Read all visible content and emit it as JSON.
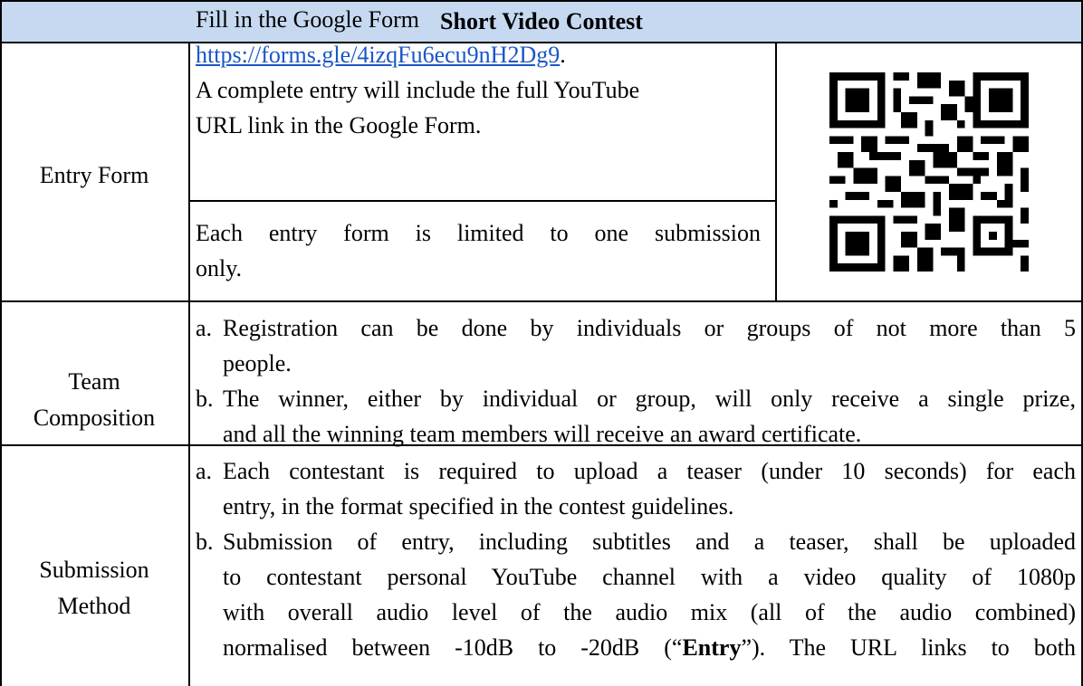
{
  "header": {
    "title": "Short Video Contest"
  },
  "entry_form": {
    "label": "Entry Form",
    "line1": "Fill in the Google Form",
    "link": "https://forms.gle/4izqFu6ecu9nH2Dg9",
    "link_suffix": ".",
    "line3": "A complete entry will include the full YouTube",
    "line4": "URL link in the Google Form.",
    "limit_line1": "Each entry form is limited to one submission",
    "limit_line2": "only.",
    "qr_icon": "qr-code-icon"
  },
  "team_composition": {
    "label_line1": "Team",
    "label_line2": "Composition",
    "items": [
      {
        "marker": "a.",
        "line1": "Registration can be done by individuals or groups of not more than 5",
        "line2": "people."
      },
      {
        "marker": "b.",
        "line1": "The winner, either by individual or group, will only receive a single prize,",
        "line2": "and all the winning team members will receive an award certificate."
      }
    ]
  },
  "submission_method": {
    "label_line1": "Submission",
    "label_line2": "Method",
    "items": [
      {
        "marker": "a.",
        "line1": "Each contestant is required to upload a teaser (under 10 seconds) for each",
        "line2": "entry, in the format specified in the contest guidelines."
      },
      {
        "marker": "b.",
        "line1": "Submission of entry, including subtitles and a teaser, shall be uploaded",
        "line2": "to contestant personal YouTube channel with a video quality of 1080p",
        "line3": "with overall audio level of the audio mix (all of the audio combined)",
        "line4_pre": "normalised between -10dB to -20dB (“",
        "line4_bold": "Entry",
        "line4_post": "”). The URL links to both"
      }
    ]
  }
}
